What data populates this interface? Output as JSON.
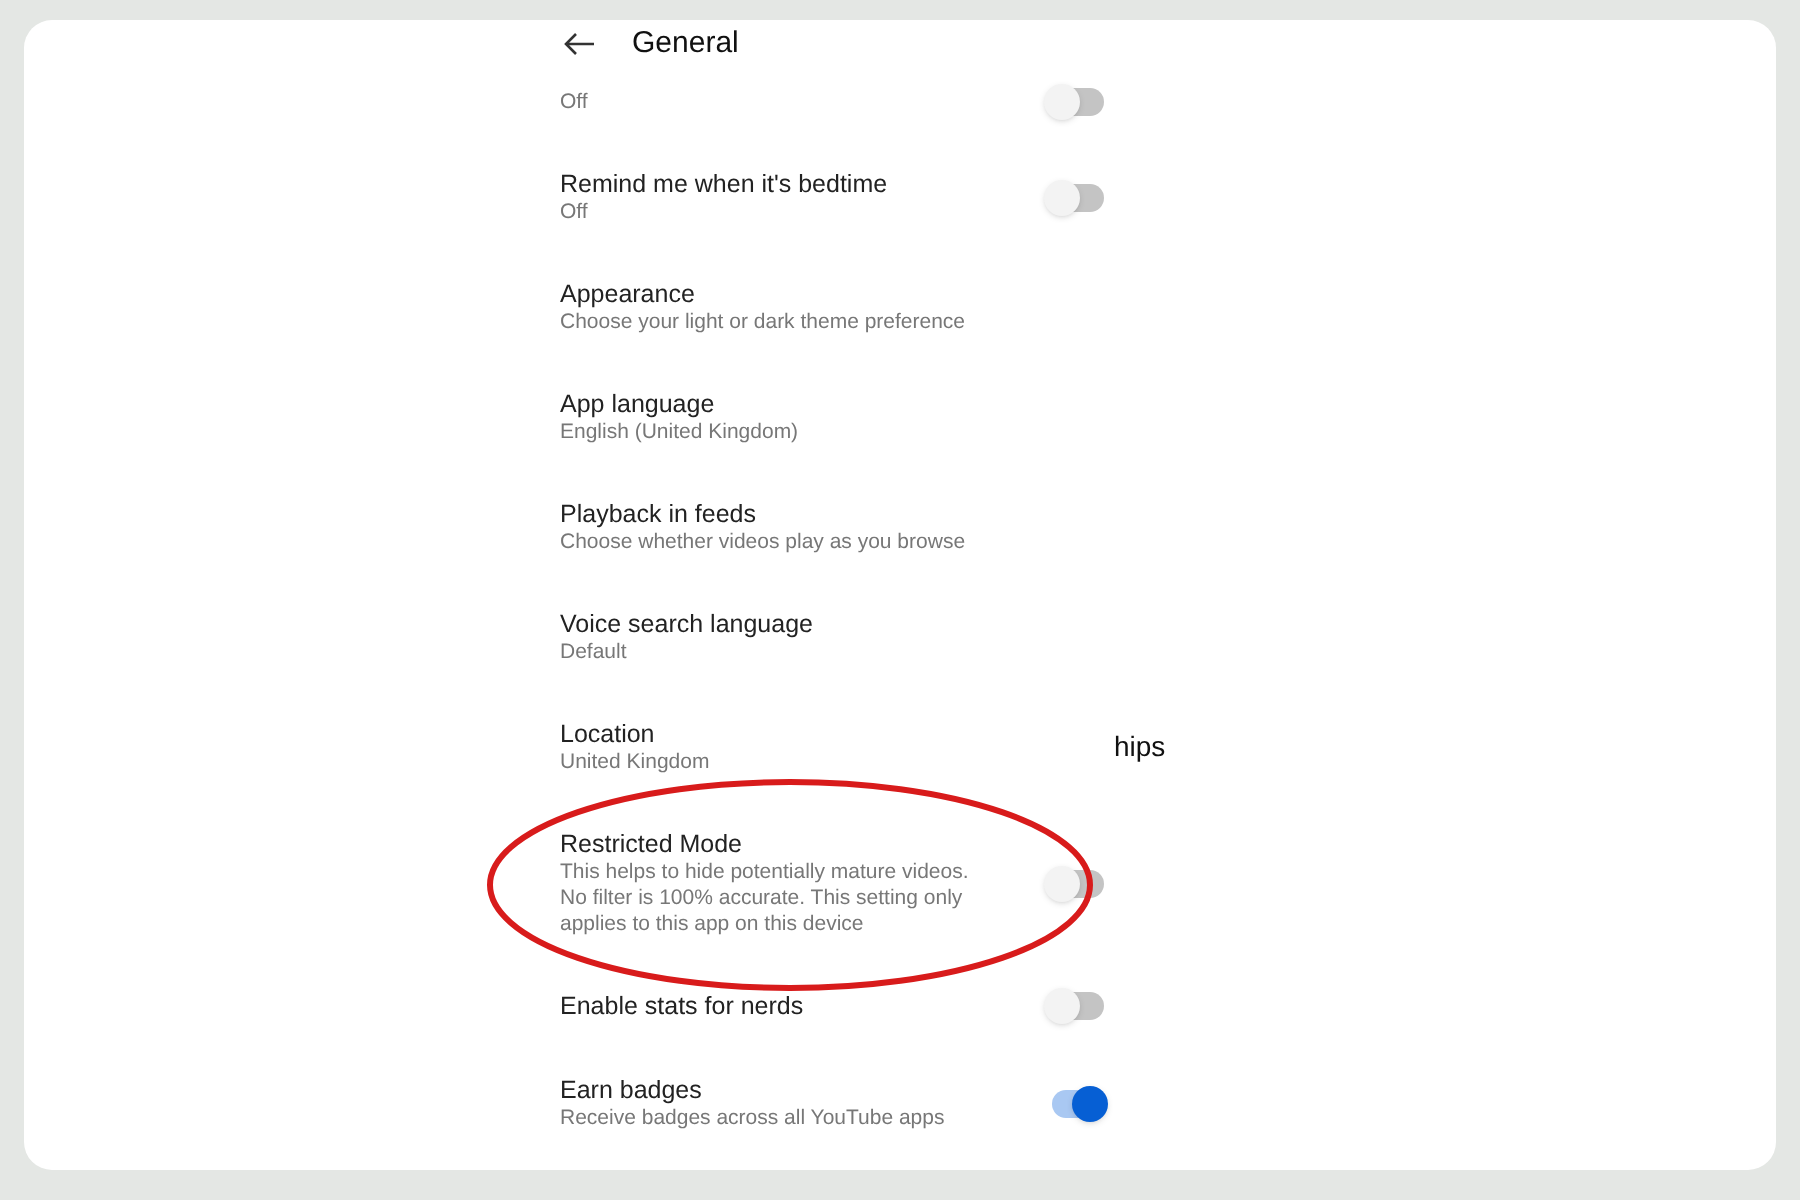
{
  "header": {
    "title": "General"
  },
  "items": [
    {
      "kind": "toggle",
      "subtitle": "Off",
      "on": false
    },
    {
      "kind": "toggle",
      "title": "Remind me when it's bedtime",
      "subtitle": "Off",
      "on": false
    },
    {
      "kind": "link",
      "title": "Appearance",
      "subtitle": "Choose your light or dark theme preference"
    },
    {
      "kind": "link",
      "title": "App language",
      "subtitle": "English (United Kingdom)"
    },
    {
      "kind": "link",
      "title": "Playback in feeds",
      "subtitle": "Choose whether videos play as you browse"
    },
    {
      "kind": "link",
      "title": "Voice search language",
      "subtitle": "Default"
    },
    {
      "kind": "link",
      "title": "Location",
      "subtitle": "United Kingdom"
    },
    {
      "kind": "toggle",
      "title": "Restricted Mode",
      "subtitle": "This helps to hide potentially mature videos. No filter is 100% accurate. This setting only applies to this app on this device",
      "on": false,
      "highlighted": true
    },
    {
      "kind": "toggle",
      "title": "Enable stats for nerds",
      "on": false
    },
    {
      "kind": "toggle",
      "title": "Earn badges",
      "subtitle": "Receive badges across all YouTube apps",
      "on": true
    }
  ],
  "stray_text": "hips"
}
